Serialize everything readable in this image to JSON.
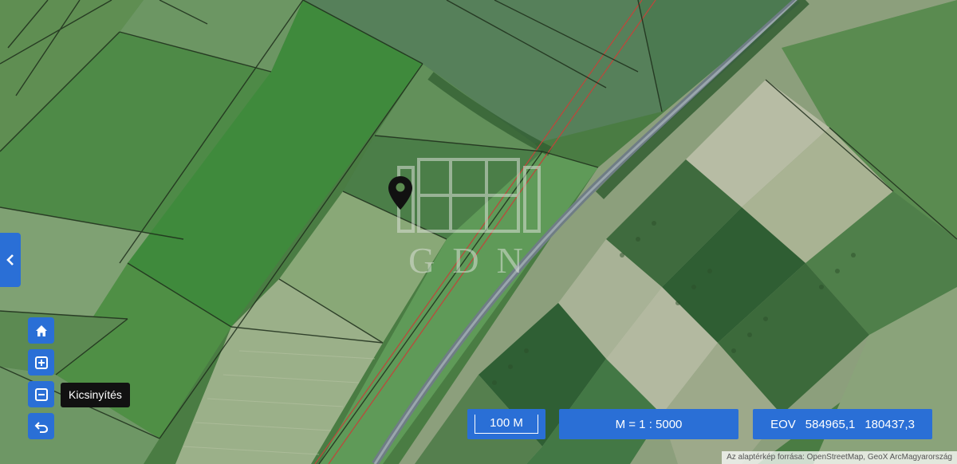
{
  "map": {
    "watermark_text": "GDN",
    "layer_colors": {
      "field_dark": "#3f7d3c",
      "field_mid": "#5a8d4f",
      "field_light": "#8faa7a",
      "field_pale": "#a7b596",
      "road": "#6c7a82",
      "parcel_line": "#1e2e1b",
      "power_line": "#c0453a"
    },
    "marker_icon": "map-pin-icon"
  },
  "controls": {
    "side_toggle_icon": "chevron-left-icon",
    "home_icon": "home-icon",
    "zoom_in_icon": "plus-square-icon",
    "zoom_out_icon": "minus-square-icon",
    "back_icon": "undo-arrow-icon",
    "tooltip": "Kicsinyítés"
  },
  "status": {
    "scale_bar": "100 M",
    "ratio": "M = 1 : 5000",
    "eov_label": "EOV",
    "eov_x": "584965,1",
    "eov_y": "180437,3"
  },
  "attribution": "Az alaptérkép forrása: OpenStreetMap, GeoX ArcMagyarország",
  "accent_color": "#2a6fd6"
}
